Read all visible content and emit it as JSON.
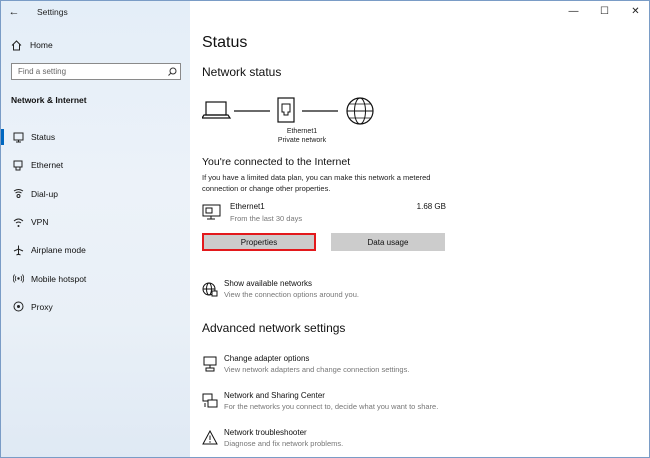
{
  "window": {
    "app_title": "Settings",
    "back_glyph": "←",
    "controls": {
      "minimize": "—",
      "maximize": "☐",
      "close": "✕"
    }
  },
  "sidebar": {
    "home_label": "Home",
    "search_placeholder": "Find a setting",
    "section_label": "Network & Internet",
    "items": [
      {
        "label": "Status",
        "icon": "status-icon",
        "active": true
      },
      {
        "label": "Ethernet",
        "icon": "ethernet-icon"
      },
      {
        "label": "Dial-up",
        "icon": "dialup-icon"
      },
      {
        "label": "VPN",
        "icon": "vpn-icon"
      },
      {
        "label": "Airplane mode",
        "icon": "airplane-icon"
      },
      {
        "label": "Mobile hotspot",
        "icon": "hotspot-icon"
      },
      {
        "label": "Proxy",
        "icon": "proxy-icon"
      }
    ]
  },
  "main": {
    "title": "Status",
    "network_status_heading": "Network status",
    "diagram": {
      "adapter_name": "Ethernet1",
      "network_type": "Private network"
    },
    "connected_text": "You're connected to the Internet",
    "description": "If you have a limited data plan, you can make this network a metered connection or change other properties.",
    "connection": {
      "name": "Ethernet1",
      "subtitle": "From the last 30 days",
      "usage": "1.68 GB"
    },
    "buttons": {
      "properties": "Properties",
      "data_usage": "Data usage"
    },
    "show_networks": {
      "title": "Show available networks",
      "desc": "View the connection options around you."
    },
    "advanced_heading": "Advanced network settings",
    "advanced_items": [
      {
        "title": "Change adapter options",
        "desc": "View network adapters and change connection settings.",
        "icon": "adapter-icon"
      },
      {
        "title": "Network and Sharing Center",
        "desc": "For the networks you connect to, decide what you want to share.",
        "icon": "sharing-icon"
      },
      {
        "title": "Network troubleshooter",
        "desc": "Diagnose and fix network problems.",
        "icon": "warning-icon"
      }
    ]
  },
  "colors": {
    "accent": "#0067c0",
    "highlight_border": "#e3191c",
    "button_bg": "#cccccc"
  }
}
